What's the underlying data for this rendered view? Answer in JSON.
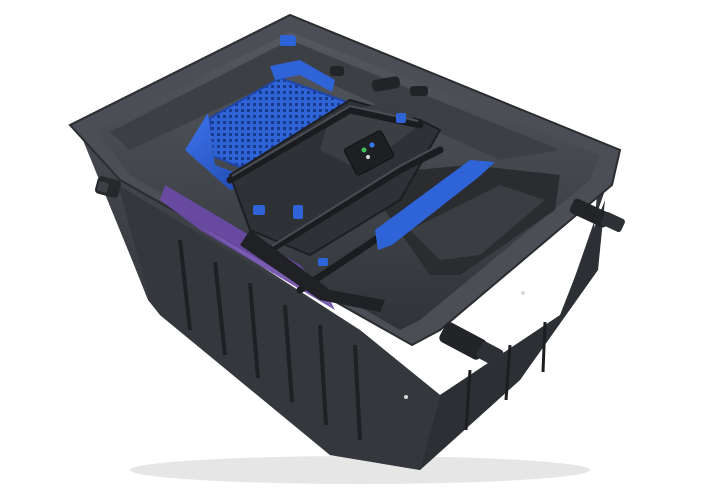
{
  "image": {
    "subject": "pond-filter-unit",
    "colors": {
      "background": "#ffffff",
      "tank_dark": "#2b2d31",
      "tank_mid": "#3a3d42",
      "tank_light": "#4a4e54",
      "rim": "#52565c",
      "accent_blue": "#2f63d8",
      "accent_blue_dark": "#1f46a8",
      "purple_media": "#6b4aa8",
      "control_led_green": "#3fbf5f",
      "control_led_blue": "#3a7bff"
    }
  }
}
